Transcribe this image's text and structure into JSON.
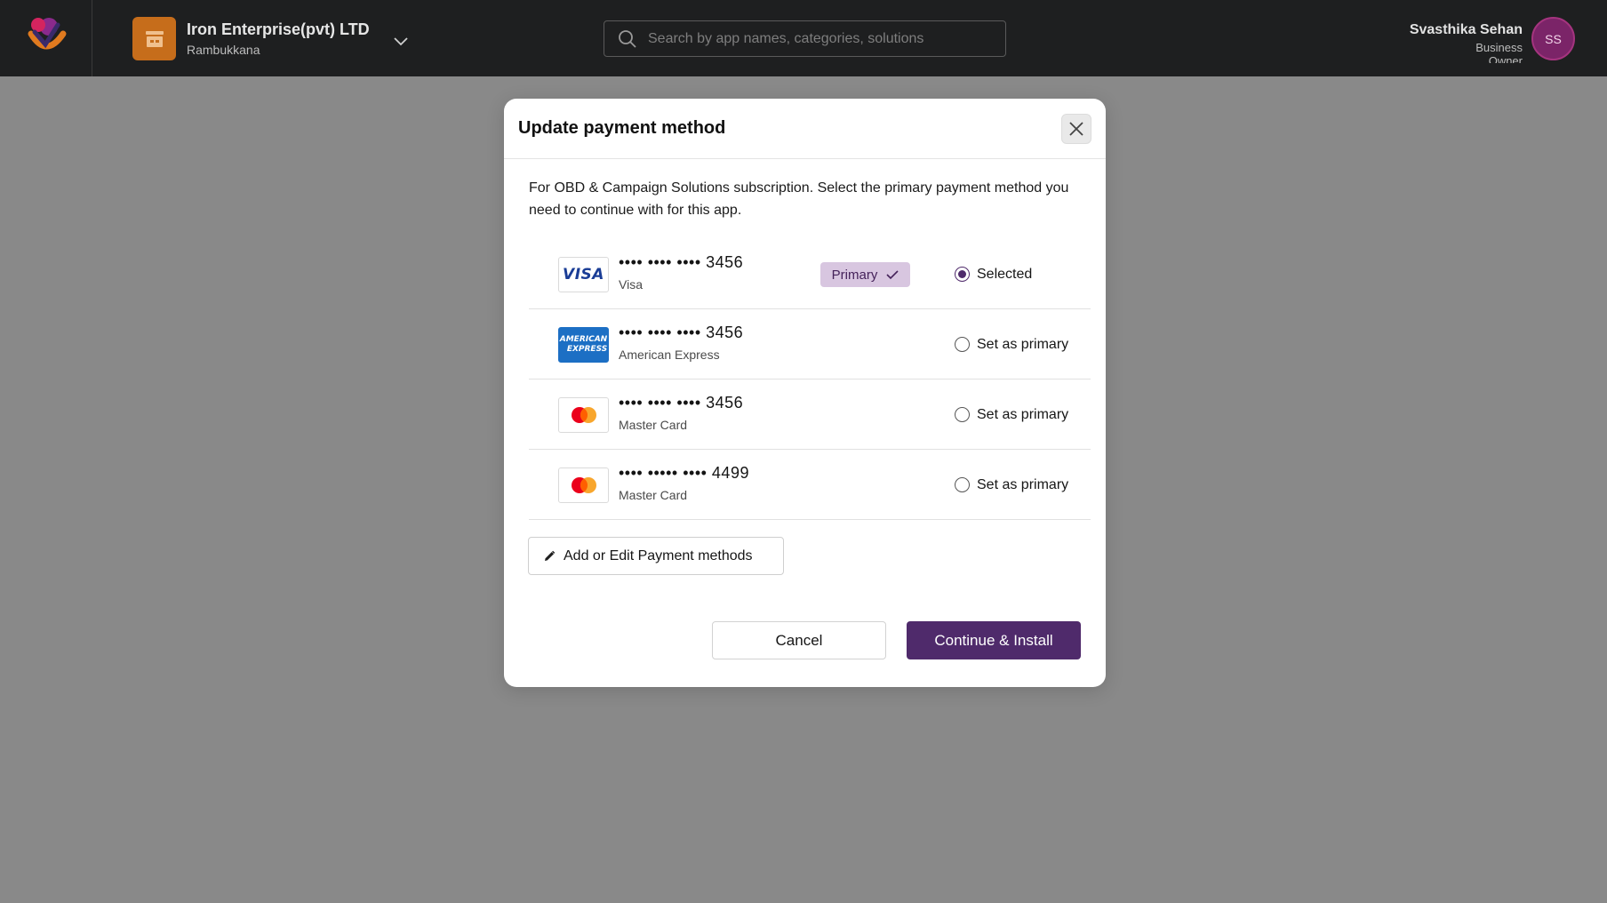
{
  "header": {
    "org_name": "Iron Enterprise(pvt) LTD",
    "org_location": "Rambukkana",
    "search_placeholder": "Search by app names, categories, solutions",
    "user_name": "Svasthika Sehan",
    "user_role": "Business Owner",
    "user_initials": "SS"
  },
  "modal": {
    "title": "Update payment method",
    "description": "For OBD & Campaign Solutions subscription. Select the primary payment method you need to continue with for this app.",
    "payment_methods": [
      {
        "number": "•••• •••• •••• 3456",
        "brand": "Visa",
        "logo": "visa-logo",
        "primary_badge": "Primary",
        "radio_label": "Selected",
        "selected": true
      },
      {
        "number": "•••• •••• •••• 3456",
        "brand": "American Express",
        "logo": "amex-logo",
        "radio_label": "Set as primary",
        "selected": false
      },
      {
        "number": "•••• •••• •••• 3456",
        "brand": "Master Card",
        "logo": "mastercard-logo",
        "radio_label": "Set as primary",
        "selected": false
      },
      {
        "number": "•••• ••••• •••• 4499",
        "brand": "Master Card",
        "logo": "mastercard-logo",
        "radio_label": "Set as primary",
        "selected": false
      }
    ],
    "edit_label": "Add or Edit Payment methods",
    "cancel_label": "Cancel",
    "continue_label": "Continue & Install",
    "amex_logo_text": [
      "AMERICAN",
      "EXPRESS"
    ],
    "visa_logo_text": "VISA"
  },
  "colors": {
    "accent": "#4f2a6b",
    "topbar": "#1e1f20",
    "overlay": "#898989",
    "org_icon": "#c66d1b",
    "badge_bg": "#d8c6e0"
  }
}
